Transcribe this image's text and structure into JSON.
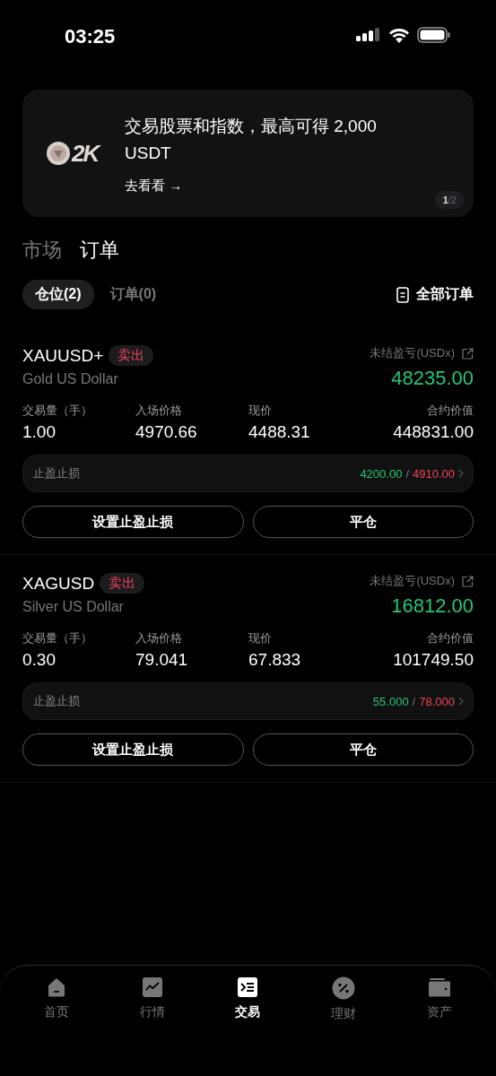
{
  "status_bar": {
    "time": "03:25"
  },
  "banner": {
    "logo_text": "2K",
    "title": "交易股票和指数，最高可得 2,000 USDT",
    "link": "去看看",
    "arrow": "→",
    "page_current": "1",
    "page_total": "/2"
  },
  "main_tabs": [
    {
      "label": "市场",
      "selected": false
    },
    {
      "label": "订单",
      "selected": true
    }
  ],
  "sub_tabs": [
    {
      "label": "仓位(2)",
      "selected": true
    },
    {
      "label": "订单(0)",
      "selected": false
    }
  ],
  "all_orders": "全部订单",
  "positions": [
    {
      "symbol": "XAUUSD+",
      "side": "卖出",
      "sell": true,
      "name": "Gold US Dollar",
      "pnl_label": "未结盈亏(USDx)",
      "pnl": "48235.00",
      "profit": true,
      "fields": [
        {
          "label": "交易量（手）",
          "value": "1.00"
        },
        {
          "label": "入场价格",
          "value": "4970.66"
        },
        {
          "label": "现价",
          "value": "4488.31"
        },
        {
          "label": "合约价值",
          "value": "448831.00"
        }
      ],
      "tpsl_label": "止盈止损",
      "take_profit": "4200.00",
      "separator": "/",
      "stop_loss": "4910.00",
      "buttons": [
        "设置止盈止损",
        "平仓"
      ]
    },
    {
      "symbol": "XAGUSD",
      "side": "卖出",
      "sell": true,
      "name": "Silver US Dollar",
      "pnl_label": "未结盈亏(USDx)",
      "pnl": "16812.00",
      "profit": true,
      "fields": [
        {
          "label": "交易量（手）",
          "value": "0.30"
        },
        {
          "label": "入场价格",
          "value": "79.041"
        },
        {
          "label": "现价",
          "value": "67.833"
        },
        {
          "label": "合约价值",
          "value": "101749.50"
        }
      ],
      "tpsl_label": "止盈止损",
      "take_profit": "55.000",
      "separator": "/",
      "stop_loss": "78.000",
      "buttons": [
        "设置止盈止损",
        "平仓"
      ]
    }
  ],
  "nav": [
    {
      "label": "首页",
      "selected": false
    },
    {
      "label": "行情",
      "selected": false
    },
    {
      "label": "交易",
      "selected": true
    },
    {
      "label": "理财",
      "selected": false
    },
    {
      "label": "资产",
      "selected": false
    }
  ]
}
